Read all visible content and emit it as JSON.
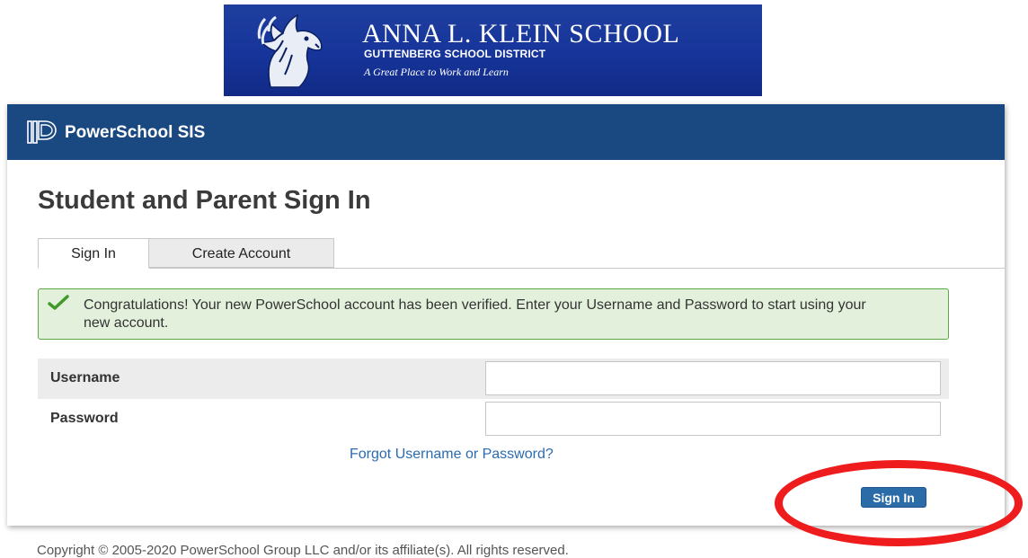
{
  "banner": {
    "school_name": "ANNA L. KLEIN SCHOOL",
    "district": "GUTTENBERG SCHOOL DISTRICT",
    "tagline": "A Great Place to Work and Learn",
    "mascot_icon": "mustang-horse-icon",
    "background_color": "#1a3a9a"
  },
  "header": {
    "product_name": "PowerSchool SIS",
    "logo_icon": "powerschool-logo-icon",
    "background_color": "#1a4880"
  },
  "page": {
    "title": "Student and Parent Sign In"
  },
  "tabs": [
    {
      "label": "Sign In",
      "active": true
    },
    {
      "label": "Create Account",
      "active": false
    }
  ],
  "message": {
    "icon": "checkmark-icon",
    "text": "Congratulations! Your new PowerSchool account has been verified. Enter your Username and Password to start using your new account.",
    "border_color": "#5fa646",
    "background_color": "#e3f1dc"
  },
  "form": {
    "username_label": "Username",
    "username_value": "",
    "password_label": "Password",
    "password_value": "",
    "forgot_link": "Forgot Username or Password?",
    "submit_label": "Sign In",
    "submit_color": "#2b6ba8"
  },
  "annotation": {
    "color": "#ee1c1c"
  },
  "footer": {
    "copyright": "Copyright © 2005-2020 PowerSchool Group LLC and/or its affiliate(s). All rights reserved."
  }
}
